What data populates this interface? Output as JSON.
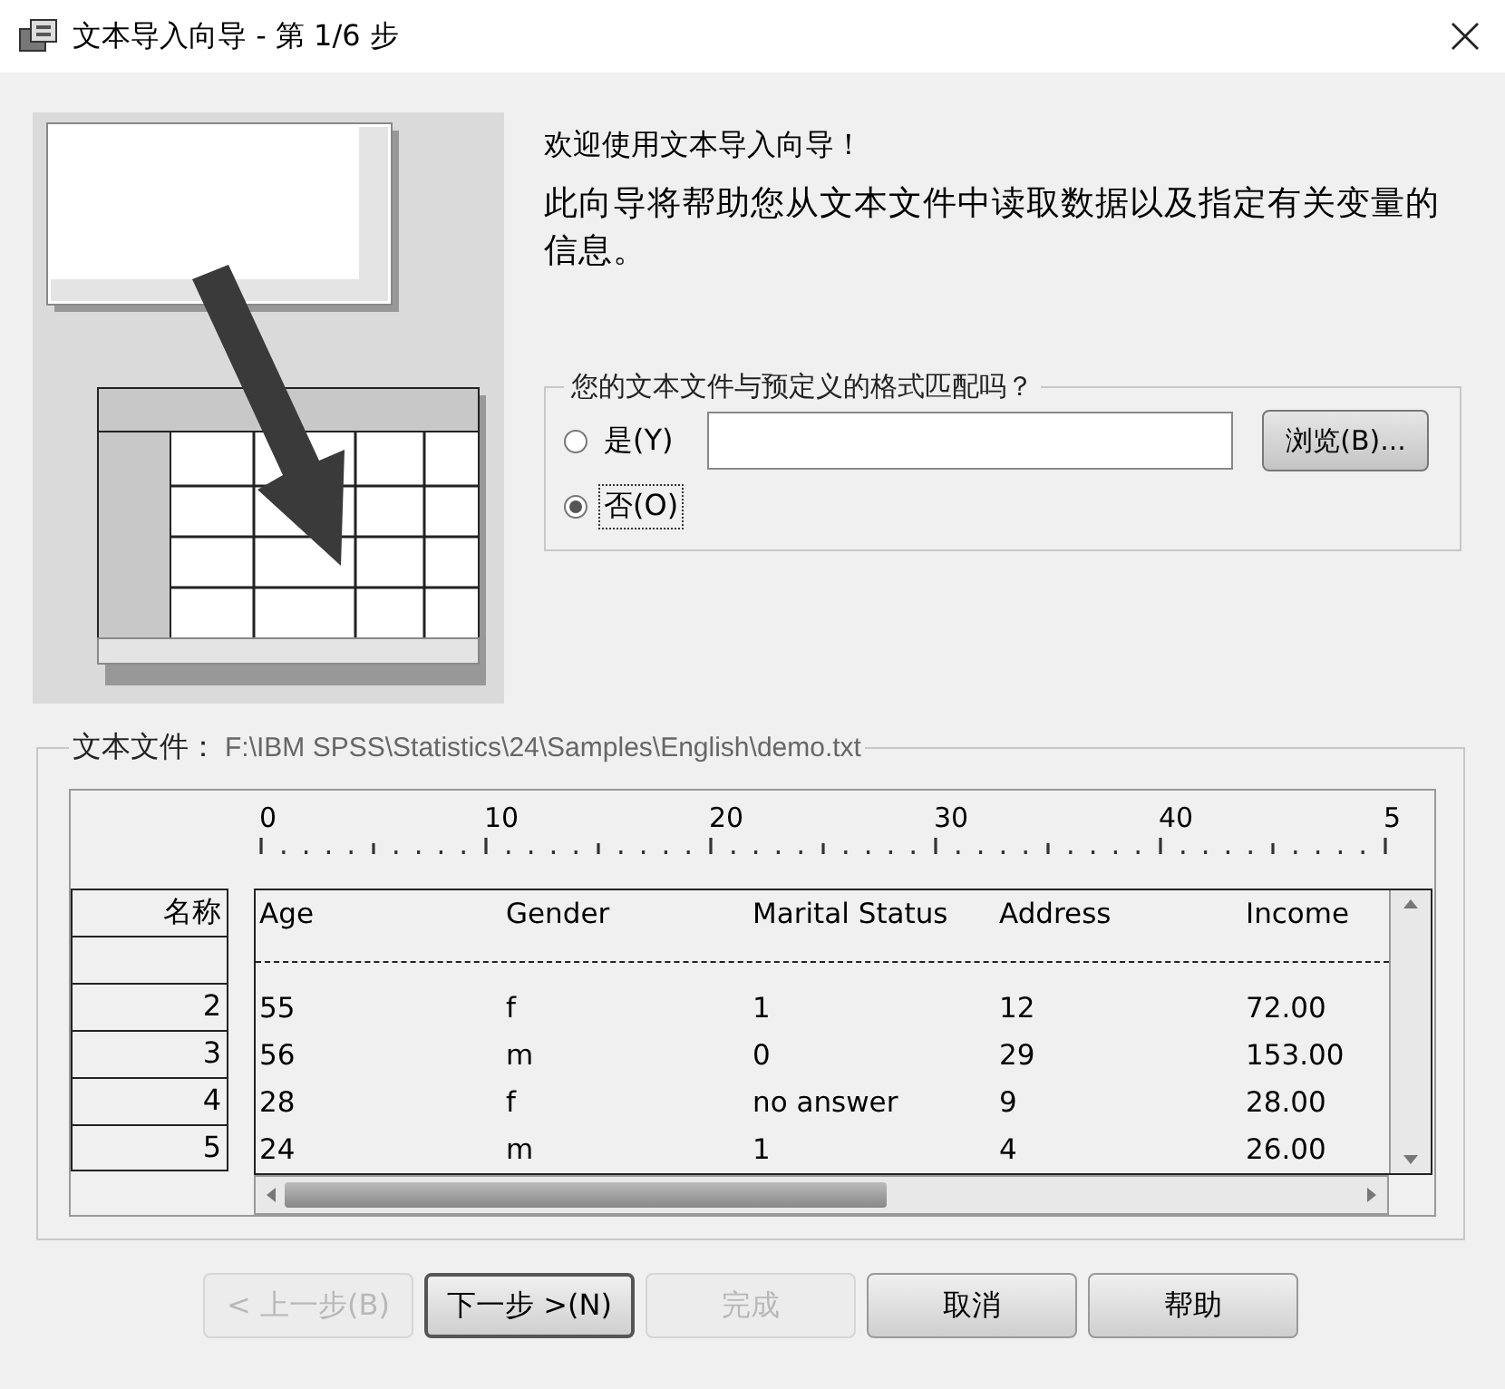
{
  "window": {
    "title": "文本导入向导 - 第 1/6 步"
  },
  "welcome": "欢迎使用文本导入向导！",
  "description": "此向导将帮助您从文本文件中读取数据以及指定有关变量的信息。",
  "match_group": {
    "legend": "您的文本文件与预定义的格式匹配吗？",
    "options": [
      {
        "label": "是(Y)",
        "selected": false,
        "focused": false
      },
      {
        "label": "否(O)",
        "selected": true,
        "focused": true
      }
    ],
    "browse_button": "浏览(B)..."
  },
  "file_group": {
    "label": "文本文件：",
    "path": "F:\\IBM SPSS\\Statistics\\24\\Samples\\English\\demo.txt"
  },
  "preview": {
    "ruler": [
      "0",
      "10",
      "20",
      "30",
      "40",
      "5"
    ],
    "name_column": {
      "header": "名称",
      "rows": [
        "2",
        "3",
        "4",
        "5"
      ]
    },
    "columns": [
      "Age",
      "Gender",
      "Marital Status",
      "Address",
      "Income"
    ],
    "rows": [
      [
        "55",
        "f",
        "1",
        "12",
        "72.00"
      ],
      [
        "56",
        "m",
        "0",
        "29",
        "153.00"
      ],
      [
        "28",
        "f",
        "no answer",
        "9",
        "28.00"
      ],
      [
        "24",
        "m",
        "1",
        "4",
        "26.00"
      ]
    ]
  },
  "buttons": [
    {
      "label": "< 上一步(B)",
      "disabled": true,
      "default": false
    },
    {
      "label": "下一步 >(N)",
      "disabled": false,
      "default": true
    },
    {
      "label": "完成",
      "disabled": true,
      "default": false
    },
    {
      "label": "取消",
      "disabled": false,
      "default": false
    },
    {
      "label": "帮助",
      "disabled": false,
      "default": false
    }
  ]
}
